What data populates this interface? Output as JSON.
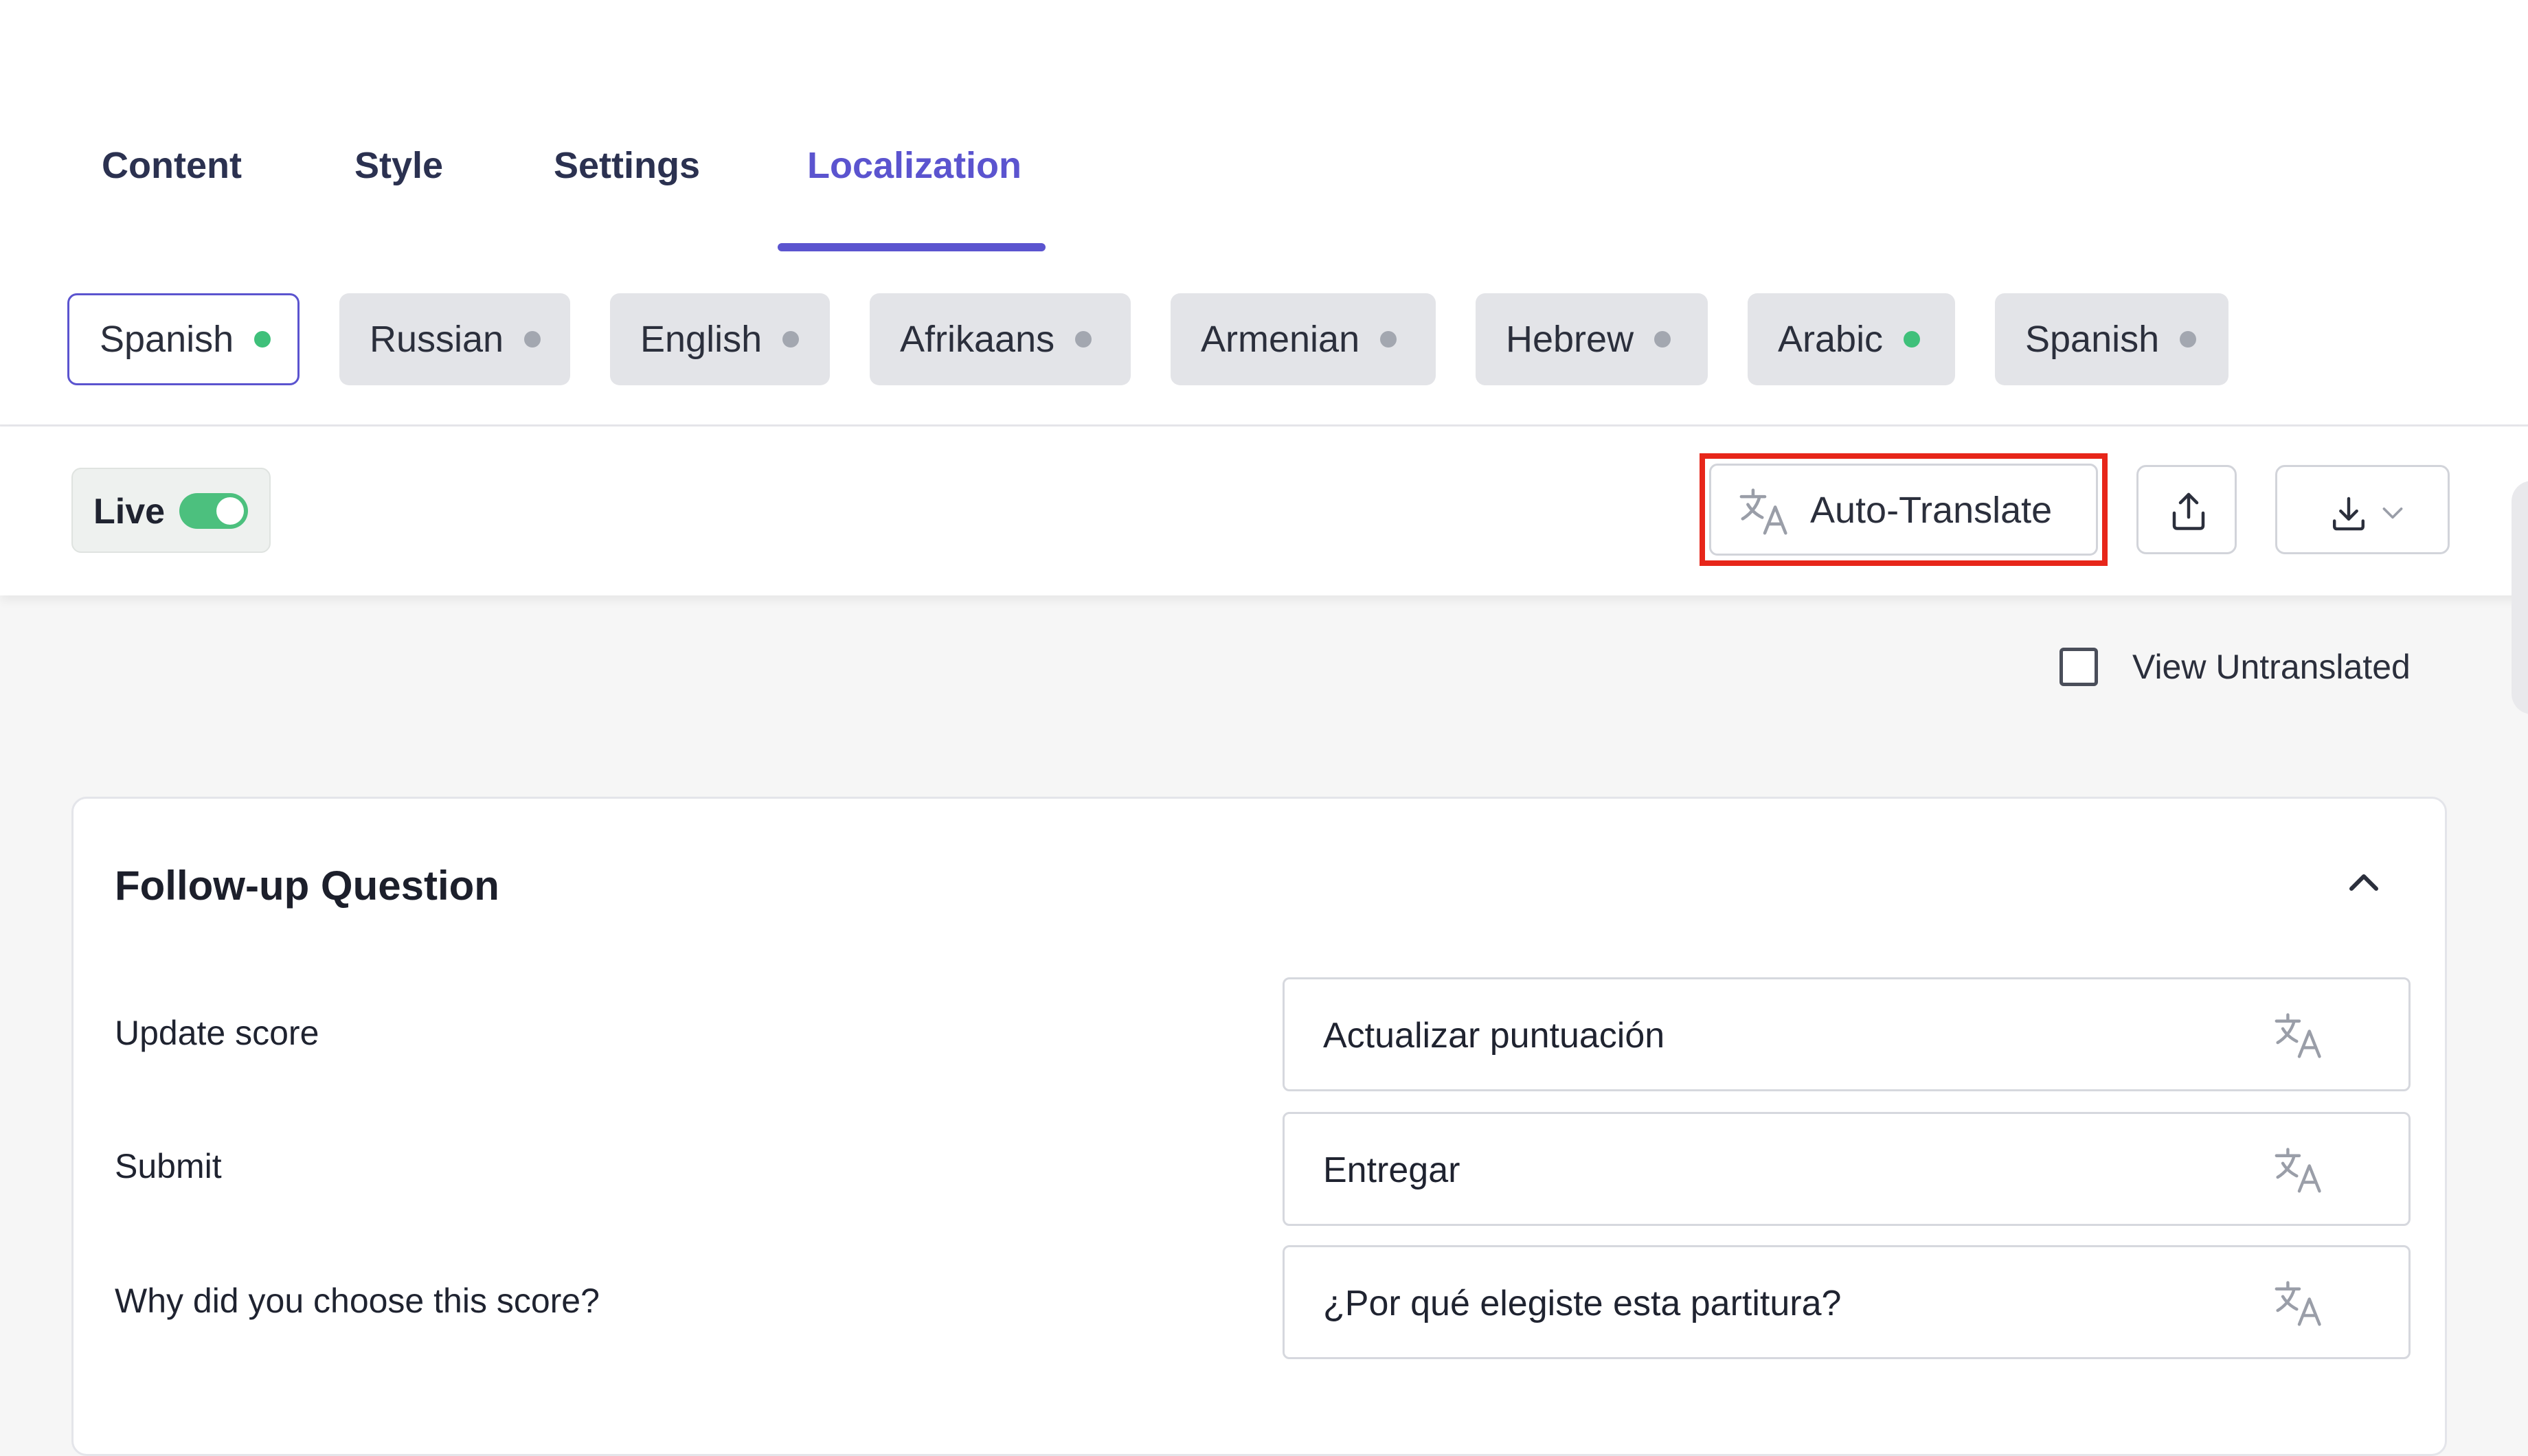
{
  "tabs": [
    {
      "label": "Content"
    },
    {
      "label": "Style"
    },
    {
      "label": "Settings"
    },
    {
      "label": "Localization",
      "active": true
    }
  ],
  "languages": [
    {
      "label": "Spanish",
      "status": "green",
      "selected": true
    },
    {
      "label": "Russian",
      "status": "gray"
    },
    {
      "label": "English",
      "status": "gray"
    },
    {
      "label": "Afrikaans",
      "status": "gray"
    },
    {
      "label": "Armenian",
      "status": "gray"
    },
    {
      "label": "Hebrew",
      "status": "gray"
    },
    {
      "label": "Arabic",
      "status": "green"
    },
    {
      "label": "Spanish",
      "status": "gray"
    }
  ],
  "toolbar": {
    "live_label": "Live",
    "live_on": true,
    "auto_translate_label": "Auto-Translate",
    "auto_translate_icon": "translate-icon",
    "upload_icon": "upload-icon",
    "download_icon": "download-icon",
    "dropdown_icon": "chevron-down-icon"
  },
  "view_untranslated": {
    "label": "View Untranslated",
    "checked": false
  },
  "card": {
    "title": "Follow-up Question",
    "collapse_icon": "chevron-up-icon",
    "rows": [
      {
        "source": "Update score",
        "translation": "Actualizar puntuación"
      },
      {
        "source": "Submit",
        "translation": "Entregar"
      },
      {
        "source": "Why did you choose this score?",
        "translation": "¿Por qué elegiste esta partitura?"
      }
    ]
  },
  "colors": {
    "accent": "#5b54cf",
    "highlight": "#e7261a",
    "status_green": "#3fc07a",
    "status_gray": "#a3a7b0",
    "toggle_on": "#4cc07e"
  }
}
